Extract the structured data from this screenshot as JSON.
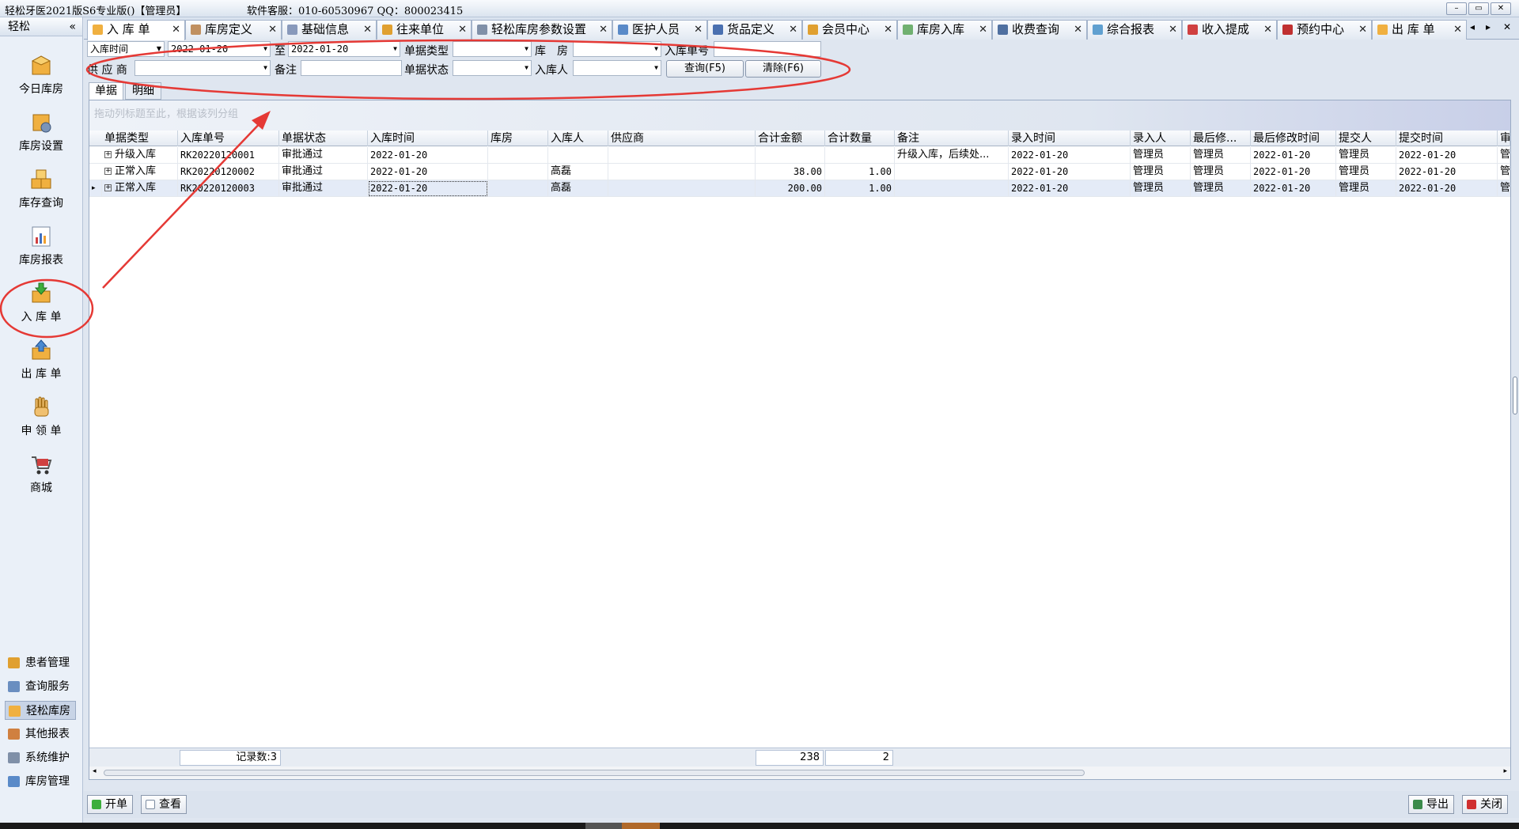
{
  "window": {
    "title": "轻松牙医2021版S6专业版()【管理员】",
    "support": "软件客服：010-60530967 QQ：800023415",
    "controls": [
      "–",
      "▭",
      "✕"
    ]
  },
  "sidebar": {
    "header": "轻松",
    "collapse": "«",
    "big_items": [
      {
        "label": "今日库房",
        "icon": "box-icon"
      },
      {
        "label": "库房设置",
        "icon": "warehouse-settings-icon"
      },
      {
        "label": "库存查询",
        "icon": "boxes-icon"
      },
      {
        "label": "库房报表",
        "icon": "report-chart-icon"
      },
      {
        "label": "入 库 单",
        "icon": "inbound-icon"
      },
      {
        "label": "出 库 单",
        "icon": "outbound-icon"
      },
      {
        "label": "申 领 单",
        "icon": "hand-icon"
      },
      {
        "label": "商城",
        "icon": "cart-icon"
      }
    ],
    "small_items": [
      {
        "label": "患者管理",
        "icon": "people-icon"
      },
      {
        "label": "查询服务",
        "icon": "search-icon"
      },
      {
        "label": "轻松库房",
        "icon": "warehouse-icon"
      },
      {
        "label": "其他报表",
        "icon": "report-icon"
      },
      {
        "label": "系统维护",
        "icon": "gear-icon"
      },
      {
        "label": "库房管理",
        "icon": "manage-icon"
      }
    ]
  },
  "tabs": [
    {
      "label": "入 库 单",
      "active": true
    },
    {
      "label": "库房定义"
    },
    {
      "label": "基础信息"
    },
    {
      "label": "往来单位"
    },
    {
      "label": "轻松库房参数设置"
    },
    {
      "label": "医护人员"
    },
    {
      "label": "货品定义"
    },
    {
      "label": "会员中心"
    },
    {
      "label": "库房入库"
    },
    {
      "label": "收费查询"
    },
    {
      "label": "综合报表"
    },
    {
      "label": "收入提成"
    },
    {
      "label": "预约中心"
    },
    {
      "label": "出 库 单"
    }
  ],
  "tab_nav": [
    "◂",
    "▸",
    "✕"
  ],
  "filters": {
    "date_type": "入库时间",
    "date_from": "2022-01-20",
    "to_label": "至",
    "date_to": "2022-01-20",
    "doc_type_label": "单据类型",
    "doc_type_value": "",
    "warehouse_label": "库　房",
    "warehouse_value": "",
    "doc_no_label": "入库单号",
    "doc_no_value": "",
    "supplier_label": "供 应 商",
    "supplier_value": "",
    "remark_label": "备注",
    "remark_value": "",
    "doc_status_label": "单据状态",
    "doc_status_value": "",
    "receiver_label": "入库人",
    "receiver_value": "",
    "query_button": "查询(F5)",
    "clear_button": "清除(F6)"
  },
  "subtabs": [
    "单据",
    "明细"
  ],
  "grid": {
    "group_hint": "拖动列标题至此，根据该列分组",
    "columns": [
      "单据类型",
      "入库单号",
      "单据状态",
      "入库时间",
      "库房",
      "入库人",
      "供应商",
      "合计金额",
      "合计数量",
      "备注",
      "录入时间",
      "录入人",
      "最后修...",
      "最后修改时间",
      "提交人",
      "提交时间",
      "审核"
    ],
    "rows": [
      [
        "升级入库",
        "RK20220120001",
        "审批通过",
        "2022-01-20",
        "",
        "",
        "",
        "",
        "",
        "升级入库，后续处...",
        "2022-01-20",
        "管理员",
        "管理员",
        "2022-01-20",
        "管理员",
        "2022-01-20",
        "管"
      ],
      [
        "正常入库",
        "RK20220120002",
        "审批通过",
        "2022-01-20",
        "",
        "高磊",
        "",
        "38.00",
        "1.00",
        "",
        "2022-01-20",
        "管理员",
        "管理员",
        "2022-01-20",
        "管理员",
        "2022-01-20",
        "管"
      ],
      [
        "正常入库",
        "RK20220120003",
        "审批通过",
        "2022-01-20",
        "",
        "高磊",
        "",
        "200.00",
        "1.00",
        "",
        "2022-01-20",
        "管理员",
        "管理员",
        "2022-01-20",
        "管理员",
        "2022-01-20",
        "管"
      ]
    ],
    "selected_row": 2,
    "footer": {
      "record_count": "记录数:3",
      "total_amount": "238",
      "total_qty": "2"
    }
  },
  "bottom": {
    "new_button": "开单",
    "view_button": "查看",
    "export_button": "导出",
    "close_button": "关闭"
  },
  "colors": {
    "annotation": "#e53935",
    "selected_row": "#e4ebf7",
    "accent": "#2f5f9e"
  }
}
